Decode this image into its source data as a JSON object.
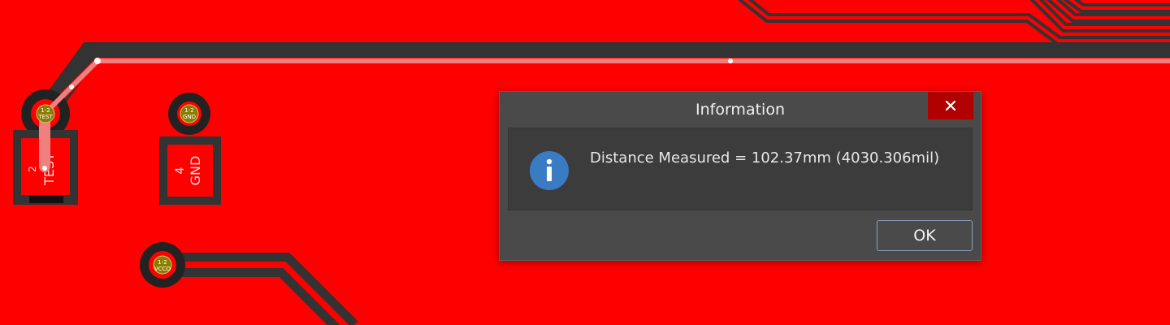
{
  "pcb": {
    "pads": [
      {
        "id": "test",
        "designator": "2",
        "net": "TEST",
        "via_label_1": "1-2",
        "via_label_2": "TEST"
      },
      {
        "id": "gnd",
        "designator": "4",
        "net": "GND",
        "via_label_1": "1-2",
        "via_label_2": "GND"
      }
    ],
    "vcco_via": {
      "label_1": "1-2",
      "label_2": "VCCO"
    },
    "colors": {
      "copper": "#ff0000",
      "clearance": "#333333",
      "measure_line": "#f08080",
      "via_fill": "#8b7d00"
    }
  },
  "dialog": {
    "title": "Information",
    "close_glyph": "✕",
    "message": "Distance Measured = 102.37mm (4030.306mil)",
    "icon": "info-icon",
    "ok_label": "OK",
    "colors": {
      "close_bg": "#b00000",
      "icon_bg": "#3a7cc4"
    }
  }
}
